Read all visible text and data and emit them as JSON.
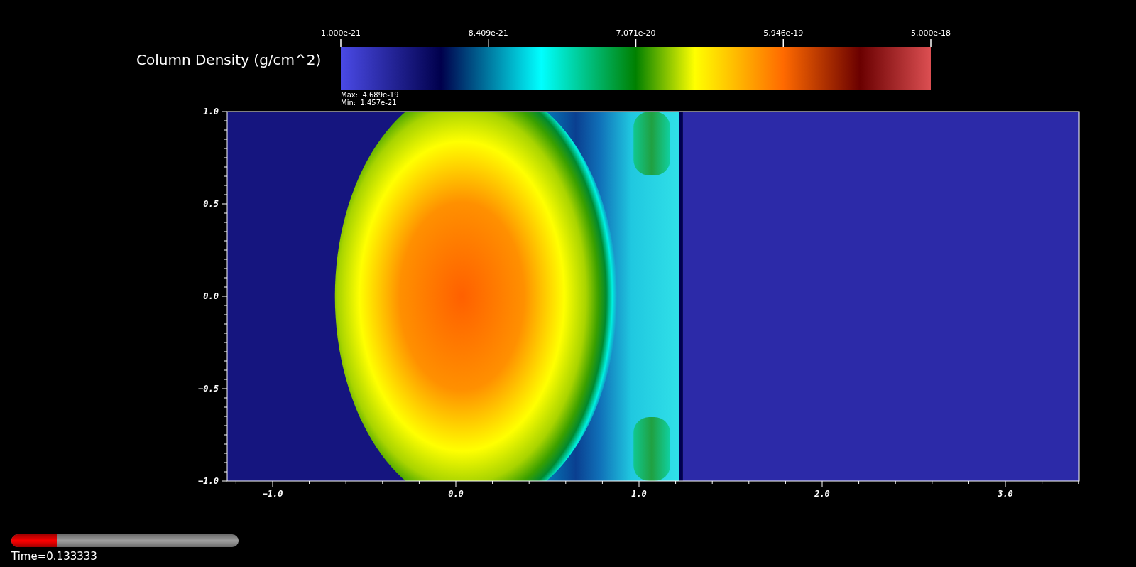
{
  "colorbar": {
    "title": "Column Density (g/cm^2)",
    "ticks": [
      "1.000e-21",
      "8.409e-21",
      "7.071e-20",
      "5.946e-19",
      "5.000e-18"
    ],
    "max": "Max:  4.689e-19",
    "min": "Min:  1.457e-21"
  },
  "plot": {
    "yticks": [
      "1.0",
      "0.5",
      "0.0",
      "−0.5",
      "−1.0"
    ],
    "xticks": [
      "−1.0",
      "0.0",
      "1.0",
      "2.0",
      "3.0"
    ]
  },
  "time_slider": {
    "level": 0.2,
    "label": "Time=0.133333"
  }
}
